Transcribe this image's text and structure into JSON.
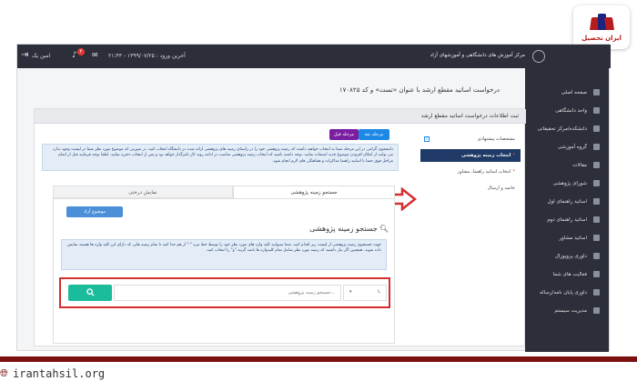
{
  "logo": {
    "text": "ایران تحصیل"
  },
  "topbar": {
    "user": "امین یک",
    "notification_count": "۴",
    "last_login": "آخرین ورود : ۱۳۹۹/۰۷/۲۵ - ۲۱:۴۳",
    "brand": "مرکز آموزش های دانشگاهی و آموزشهای آزاد"
  },
  "sidebar": {
    "items": [
      {
        "label": "صفحه اصلی"
      },
      {
        "label": "واحد دانشگاهی"
      },
      {
        "label": "دانشکده/مرکز تحقیقاتی"
      },
      {
        "label": "گروه آموزشی"
      },
      {
        "label": "مقالات"
      },
      {
        "label": "شورای پژوهشی"
      },
      {
        "label": "اساتید راهنمای اول"
      },
      {
        "label": "اساتید راهنمای دوم"
      },
      {
        "label": "اساتید مشاور"
      },
      {
        "label": "داوری پروپوزال"
      },
      {
        "label": "فعالیت های شما"
      },
      {
        "label": "داوری پایان نامه/رساله"
      },
      {
        "label": "مدیریت سیستم"
      }
    ]
  },
  "page": {
    "title": "درخواست اساتید مقطع ارشد با عنوان «تست» و کد ۱۷۰۸۲۵",
    "panel_title": "ثبت اطلاعات درخواست اساتید مقطع ارشد"
  },
  "steps": [
    {
      "label": "مشخصات پیشنهادی",
      "check": "✓"
    },
    {
      "label": "انتخاب زمینه پژوهشی",
      "active": true,
      "req": "*"
    },
    {
      "label": "انتخاب اساتید راهنما، مشاور",
      "req": "*"
    },
    {
      "label": "خاتمه و ارسال"
    }
  ],
  "nav": {
    "prev": "مرحله قبل",
    "next": "مرحله بعد"
  },
  "info_text": "دانشجوی گرامی در این مرحله شما به انتخاب خواهید داشت که زمینه پژوهشی خود را در راستای زمینه های پژوهشی ارائه شده در دانشگاه انتخاب کنید. در صورتی که موضوع مورد نظر شما در لیست وجود ندارد می توانید از امکان افزودن موضوع جدید استفاده نمایید. توجه داشته باشید که انتخاب زمینه پژوهشی مناسب در ادامه روند کار تاثیرگذار خواهد بود و پس از انتخاب ذخیره نمایید. لطفا توجه فرمایید قبل از اتمام مراحل فوق حتما با اساتید راهنما مذاکرات و هماهنگی های لازم انجام شود.",
  "tabs": {
    "search": "جستجو زمینه پژوهشی",
    "list": "نمایش درختی"
  },
  "search": {
    "add_topic": "موضوع آزاد",
    "title": "جستجو زمینه پژوهشی",
    "hint": "جهت جستجوی زمینه پژوهشی از لیست زیر اقدام کنید. شما میتوانید کلید واژه های مورد نظر خود را توسط خط تیره \"-\" از هم جدا کنید تا تمام زمینه هایی که دارای این کلید واژه ها هستند نمایش داده شوند. همچنین اگر نیاز داشتید که زمینه مورد نظر شامل تمام کلیدواژه ها باشد گزینه \"و\" را انتخاب کنید.",
    "placeholder": "جستجو زمینه پژوهشی...",
    "operator": "یا",
    "button_icon": "search-icon"
  },
  "footer": {
    "url": "irantahsil.org"
  },
  "colors": {
    "sidebar": "#2c2f3a",
    "accent": "#1abc9c",
    "highlight": "#d32f2f",
    "brand": "#7b1010"
  }
}
